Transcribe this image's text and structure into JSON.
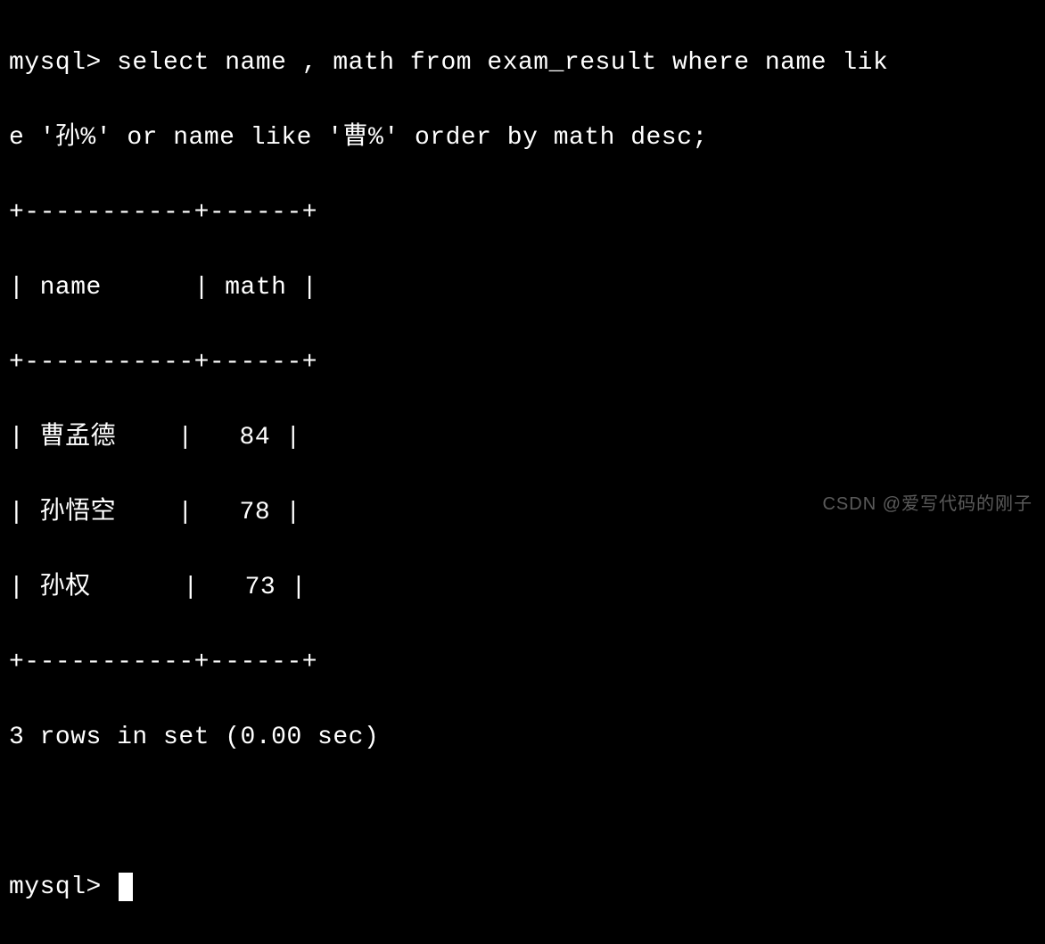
{
  "prompt1": "mysql>",
  "query_line1": "mysql> select name , math from exam_result where name lik",
  "query_line2": "e '孙%' or name like '曹%' order by math desc;",
  "table_border": "+-----------+------+",
  "table_header": "| name      | math |",
  "rows": [
    "| 曹孟德    |   84 |",
    "| 孙悟空    |   78 |",
    "| 孙权      |   73 |"
  ],
  "result_summary": "3 rows in set (0.00 sec)",
  "prompt2": "mysql> ",
  "watermark": "CSDN @爱写代码的刚子"
}
